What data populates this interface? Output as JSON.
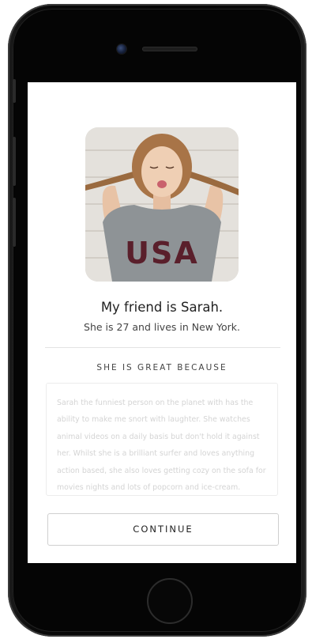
{
  "profile": {
    "photo_description_icon": "profile-photo",
    "title": "My friend is Sarah.",
    "subtitle": "She is 27 and lives in New York."
  },
  "section": {
    "heading": "SHE IS GREAT BECAUSE",
    "description": "Sarah the funniest person on the planet with has the ability to make me snort with laughter.  She watches animal videos on a daily basis but don't hold it against her.  Whilst she is a brilliant surfer and loves anything action based, she also loves getting cozy on the sofa for movies nights and lots of popcorn and ice-cream."
  },
  "actions": {
    "continue_label": "CONTINUE"
  },
  "photo": {
    "shirt_text": "USA"
  },
  "colors": {
    "screen_background": "#ffffff",
    "phone_body": "#050505",
    "text_primary": "#222222",
    "text_placeholder": "#d4d4d4",
    "shirt": "#8e9396",
    "shirt_letters": "#5a1f2b"
  }
}
